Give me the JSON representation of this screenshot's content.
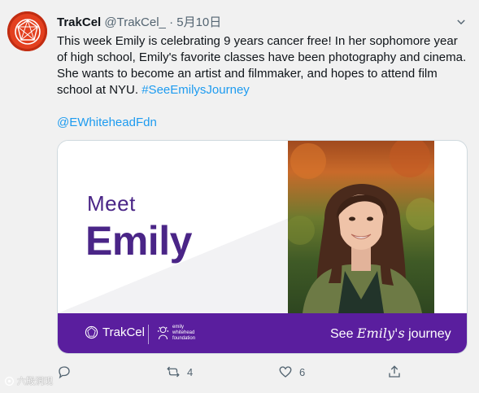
{
  "tweet": {
    "display_name": "TrakCel",
    "handle": "@TrakCel_",
    "separator": "·",
    "date": "5月10日",
    "text": "This week Emily is celebrating 9 years cancer free! In her sophomore year of high school, Emily's favorite classes have been photography and cinema. She wants to become an artist and filmmaker, and hopes to attend film school at NYU.",
    "hashtag": "#SeeEmilysJourney",
    "mention": "@EWhiteheadFdn"
  },
  "card": {
    "meet": "Meet",
    "emily": "Emily",
    "brand": "TrakCel",
    "foundation_line1": "emily",
    "foundation_line2": "whitehead",
    "foundation_line3": "foundation",
    "see_prefix": "See",
    "see_script": "Emily's",
    "see_suffix": "journey"
  },
  "actions": {
    "reply_count": "",
    "retweet_count": "4",
    "like_count": "6"
  },
  "watermark": "六殿洞观",
  "colors": {
    "accent": "#1d9bf0",
    "brand_purple": "#5a1e9e",
    "card_text_purple": "#4a2587",
    "avatar_red": "#e3401f"
  },
  "icons": [
    "trakcel-logo-icon",
    "caret-icon",
    "reply-icon",
    "retweet-icon",
    "like-icon",
    "share-icon"
  ]
}
